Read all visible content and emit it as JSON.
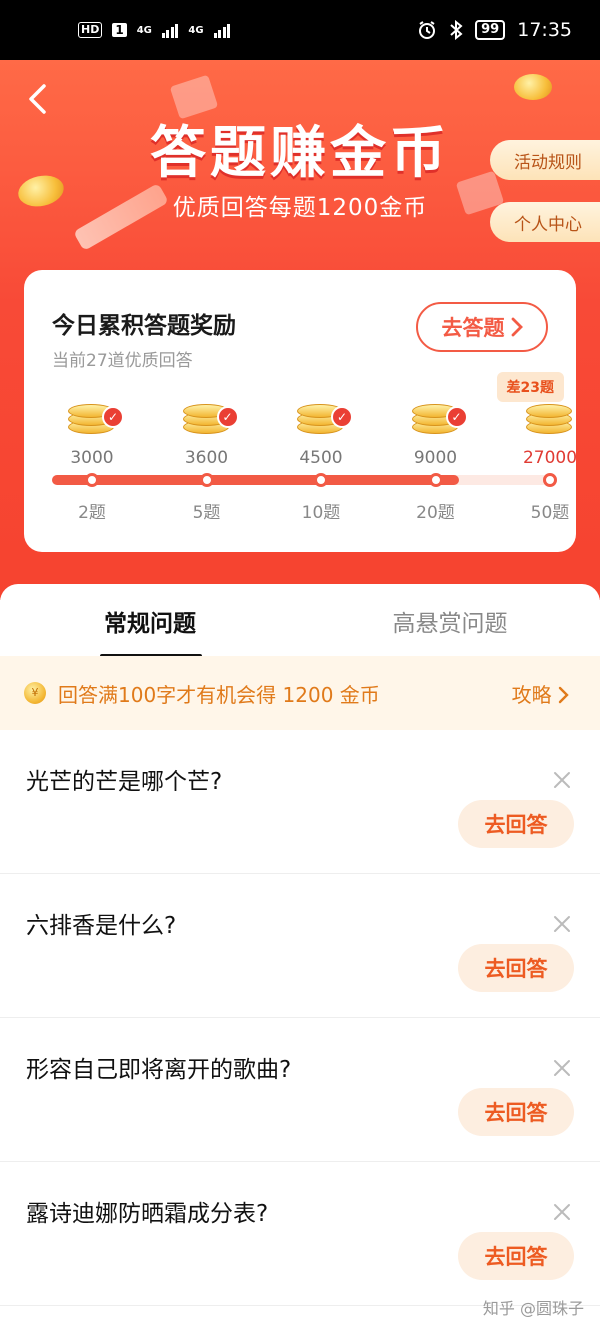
{
  "status_bar": {
    "hd": "HD",
    "sim": "1",
    "net1": "4G",
    "net2": "4G",
    "battery": "99",
    "time": "17:35"
  },
  "banner": {
    "title": "答题赚金币",
    "subtitle": "优质回答每题1200金币",
    "rules_label": "活动规则",
    "profile_label": "个人中心"
  },
  "reward_card": {
    "title": "今日累积答题奖励",
    "subtitle": "当前27道优质回答",
    "go_label": "去答题",
    "need_label": "差23题",
    "progress_fraction": 0.82,
    "stages": [
      {
        "amount": "3000",
        "questions": "2题",
        "done": true
      },
      {
        "amount": "3600",
        "questions": "5题",
        "done": true
      },
      {
        "amount": "4500",
        "questions": "10题",
        "done": true
      },
      {
        "amount": "9000",
        "questions": "20题",
        "done": true
      },
      {
        "amount": "27000",
        "questions": "50题",
        "done": false
      }
    ]
  },
  "tabs": [
    {
      "label": "常规问题",
      "active": true
    },
    {
      "label": "高悬赏问题",
      "active": false
    }
  ],
  "notice": {
    "coin_glyph": "¥",
    "text": "回答满100字才有机会得 1200 金币",
    "link": "攻略"
  },
  "questions": [
    {
      "text": "光芒的芒是哪个芒?",
      "action": "去回答"
    },
    {
      "text": "六排香是什么?",
      "action": "去回答"
    },
    {
      "text": "形容自己即将离开的歌曲?",
      "action": "去回答"
    },
    {
      "text": "露诗迪娜防晒霜成分表?",
      "action": "去回答"
    }
  ],
  "watermark": "知乎 @圆珠子",
  "colors": {
    "accent": "#f4503a",
    "orange": "#ed5b22",
    "gold": "#f3b632"
  }
}
